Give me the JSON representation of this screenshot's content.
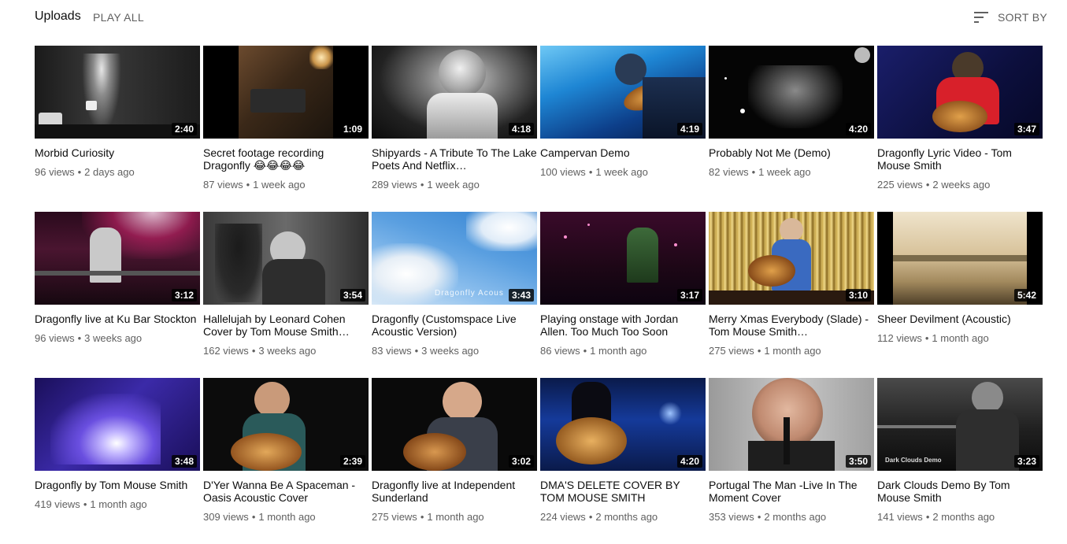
{
  "header": {
    "title": "Uploads",
    "play_all": "PLAY ALL",
    "sort_label": "SORT BY",
    "sort_icon": "sort-icon"
  },
  "videos": [
    {
      "title": "Morbid Curiosity",
      "duration": "2:40",
      "views": "96 views",
      "age": "2 days ago"
    },
    {
      "title": "Secret footage recording Dragonfly 😂😂😂😂",
      "duration": "1:09",
      "views": "87 views",
      "age": "1 week ago"
    },
    {
      "title": "Shipyards - A Tribute To The Lake Poets And Netflix…",
      "duration": "4:18",
      "views": "289 views",
      "age": "1 week ago"
    },
    {
      "title": "Campervan Demo",
      "duration": "4:19",
      "views": "100 views",
      "age": "1 week ago"
    },
    {
      "title": "Probably Not Me (Demo)",
      "duration": "4:20",
      "views": "82 views",
      "age": "1 week ago"
    },
    {
      "title": "Dragonfly Lyric Video - Tom Mouse Smith",
      "duration": "3:47",
      "views": "225 views",
      "age": "2 weeks ago"
    },
    {
      "title": "Dragonfly live at Ku Bar Stockton",
      "duration": "3:12",
      "views": "96 views",
      "age": "3 weeks ago"
    },
    {
      "title": "Hallelujah by Leonard Cohen Cover by Tom Mouse Smith…",
      "duration": "3:54",
      "views": "162 views",
      "age": "3 weeks ago"
    },
    {
      "title": "Dragonfly (Customspace Live Acoustic Version)",
      "duration": "3:43",
      "views": "83 views",
      "age": "3 weeks ago",
      "thumb_text": "Dragonfly Acous"
    },
    {
      "title": "Playing onstage with Jordan Allen. Too Much Too Soon",
      "duration": "3:17",
      "views": "86 views",
      "age": "1 month ago"
    },
    {
      "title": "Merry Xmas Everybody (Slade) - Tom Mouse Smith…",
      "duration": "3:10",
      "views": "275 views",
      "age": "1 month ago"
    },
    {
      "title": "Sheer Devilment (Acoustic)",
      "duration": "5:42",
      "views": "112 views",
      "age": "1 month ago"
    },
    {
      "title": "Dragonfly by Tom Mouse Smith",
      "duration": "3:48",
      "views": "419 views",
      "age": "1 month ago"
    },
    {
      "title": "D'Yer Wanna Be A Spaceman - Oasis Acoustic Cover",
      "duration": "2:39",
      "views": "309 views",
      "age": "1 month ago"
    },
    {
      "title": "Dragonfly live at Independent Sunderland",
      "duration": "3:02",
      "views": "275 views",
      "age": "1 month ago"
    },
    {
      "title": "DMA'S DELETE COVER BY TOM MOUSE SMITH",
      "duration": "4:20",
      "views": "224 views",
      "age": "2 months ago"
    },
    {
      "title": "Portugal The Man -Live In The Moment Cover",
      "duration": "3:50",
      "views": "353 views",
      "age": "2 months ago"
    },
    {
      "title": "Dark Clouds Demo By Tom Mouse Smith",
      "duration": "3:23",
      "views": "141 views",
      "age": "2 months ago",
      "thumb_text": "Dark Clouds Demo"
    }
  ]
}
